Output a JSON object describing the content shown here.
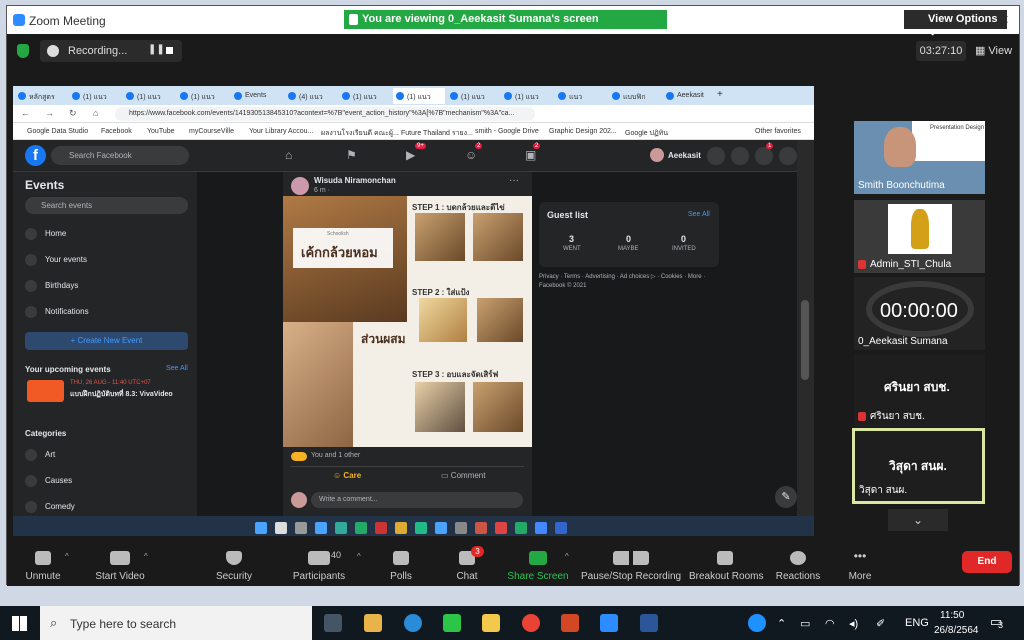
{
  "zoom": {
    "title": "Zoom Meeting",
    "banner": "You are viewing 0_Aeekasit Sumana's screen",
    "view_options": "View Options",
    "recording": "Recording...",
    "timer": "03:27:10",
    "view": "View"
  },
  "browser": {
    "tabs": [
      "หลักสูตร",
      "(1) แนว",
      "(1) แนว",
      "(1) แนว",
      "Events",
      "(4) แนว",
      "(1) แนว",
      "(1) แนว",
      "(1) แนว",
      "(1) แนว",
      "แนว",
      "แบบฟิก",
      "Aeekasit"
    ],
    "url": "https://www.facebook.com/events/141930513845310?acontext=%7B\"event_action_history\"%3A[%7B\"mechanism\"%3A\"ca...",
    "bookmarks": [
      "Google Data Studio",
      "Facebook",
      "YouTube",
      "myCourseVille",
      "Your Library Accou...",
      "ผลงานโรงเรียนดี คณะผู้...",
      "Future Thailand รายง...",
      "smith - Google Drive",
      "Graphic Design 202...",
      "Google ปฏิทิน",
      "Other favorites"
    ]
  },
  "facebook": {
    "search_placeholder": "Search Facebook",
    "events_title": "Events",
    "search_events": "Search events",
    "nav": [
      "Home",
      "Your events",
      "Birthdays",
      "Notifications"
    ],
    "create_event": "+ Create New Event",
    "upcoming_title": "Your upcoming events",
    "see_all": "See All",
    "upcoming_date": "THU, 26 AUG - 11:40 UTC+07",
    "upcoming_event": "แบบฝึกปฏิบัติบทที่ 8.3: VivaVideo",
    "categories_title": "Categories",
    "categories": [
      "Art",
      "Causes",
      "Comedy"
    ],
    "user": "Aeekasit",
    "badges": {
      "watch": "9+",
      "groups": "2",
      "gaming": "2",
      "notif": "1"
    },
    "post": {
      "author": "Wisuda Niramonchan",
      "time": "6 m · ",
      "cover_small": "Schoolish",
      "cover_title": "เค้กกล้วยหอม",
      "ingredients": "ส่วนผสม",
      "step1": "STEP 1 : บดกล้วยและตีไข่",
      "step2": "STEP 2 : ใส่แป้ง",
      "step3": "STEP 3 : อบและจัดเสิร์ฟ",
      "reactions": "You and 1 other",
      "care": "Care",
      "comment": "Comment",
      "write_comment": "Write a comment..."
    },
    "guest_list": {
      "title": "Guest list",
      "see_all": "See All",
      "went": "3",
      "went_label": "WENT",
      "maybe": "0",
      "maybe_label": "MAYBE",
      "invited": "0",
      "invited_label": "INVITED"
    },
    "footer": "Privacy · Terms · Advertising · Ad choices ▷ · Cookies · More · Facebook © 2021"
  },
  "participants": [
    {
      "name": "Smith Boonchutima"
    },
    {
      "name": "Admin_STI_Chula"
    },
    {
      "name": "0_Aeekasit Sumana",
      "timer": "00:00:00"
    },
    {
      "name": "ศรินยา สบช.",
      "center": "ศรินยา สบช."
    },
    {
      "name": "วิสุดา สนผ.",
      "center": "วิสุดา สนผ."
    }
  ],
  "video_thumb_text": "Presentation Design",
  "toolbar": {
    "unmute": "Unmute",
    "start_video": "Start Video",
    "security": "Security",
    "participants": "Participants",
    "participants_count": "40",
    "polls": "Polls",
    "chat": "Chat",
    "chat_badge": "3",
    "share_screen": "Share Screen",
    "pause_recording": "Pause/Stop Recording",
    "breakout": "Breakout Rooms",
    "reactions": "Reactions",
    "more": "More",
    "end": "End"
  },
  "windows": {
    "search": "Type here to search",
    "lang": "ENG",
    "time": "11:50",
    "date": "26/8/2564",
    "notif": "3"
  },
  "colors": {
    "zoom_green": "#23a844",
    "end_red": "#e02828",
    "fb_blue": "#1877f2",
    "active_border": "#d9e7a0"
  }
}
